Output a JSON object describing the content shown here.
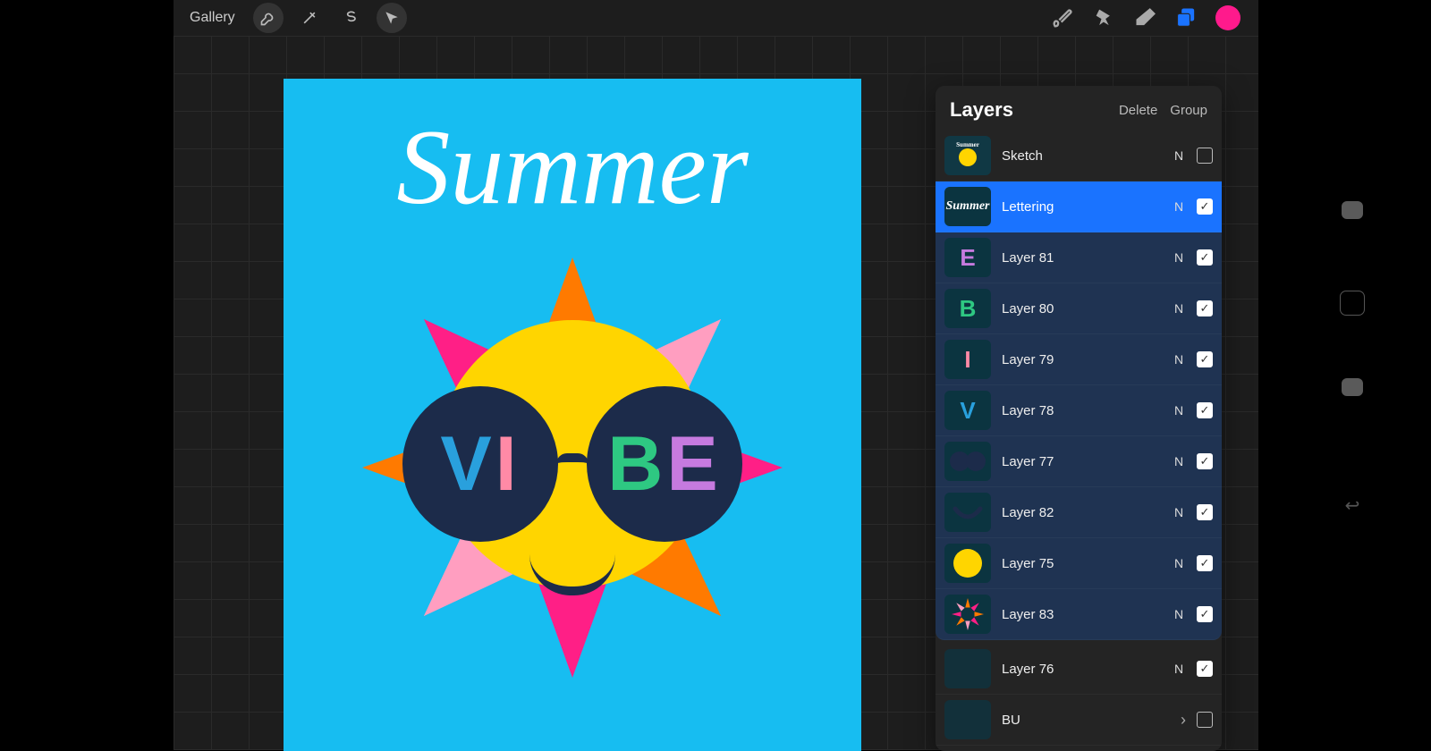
{
  "toolbar": {
    "gallery": "Gallery"
  },
  "canvas": {
    "title": "Summer",
    "vibe_v": "V",
    "vibe_i": "I",
    "vibe_b": "B",
    "vibe_e": "E"
  },
  "layers_panel": {
    "title": "Layers",
    "delete": "Delete",
    "group": "Group"
  },
  "layers": [
    {
      "name": "Sketch",
      "blend": "N",
      "visible": false,
      "grouped": false,
      "selected": false,
      "thumb": "sketch"
    },
    {
      "name": "Lettering",
      "blend": "N",
      "visible": true,
      "grouped": true,
      "selected": true,
      "thumb": "summer"
    },
    {
      "name": "Layer 81",
      "blend": "N",
      "visible": true,
      "grouped": true,
      "selected": false,
      "thumb": "E"
    },
    {
      "name": "Layer 80",
      "blend": "N",
      "visible": true,
      "grouped": true,
      "selected": false,
      "thumb": "B"
    },
    {
      "name": "Layer 79",
      "blend": "N",
      "visible": true,
      "grouped": true,
      "selected": false,
      "thumb": "I"
    },
    {
      "name": "Layer 78",
      "blend": "N",
      "visible": true,
      "grouped": true,
      "selected": false,
      "thumb": "V"
    },
    {
      "name": "Layer 77",
      "blend": "N",
      "visible": true,
      "grouped": true,
      "selected": false,
      "thumb": "glasses"
    },
    {
      "name": "Layer 82",
      "blend": "N",
      "visible": true,
      "grouped": true,
      "selected": false,
      "thumb": "smile"
    },
    {
      "name": "Layer 75",
      "blend": "N",
      "visible": true,
      "grouped": true,
      "selected": false,
      "thumb": "suncircle"
    },
    {
      "name": "Layer 83",
      "blend": "N",
      "visible": true,
      "grouped": true,
      "selected": false,
      "thumb": "sunburst",
      "last_group": true
    },
    {
      "name": "Layer 76",
      "blend": "N",
      "visible": true,
      "grouped": false,
      "selected": false,
      "thumb": "blank"
    },
    {
      "name": "BU",
      "blend": "",
      "visible": false,
      "grouped": false,
      "selected": false,
      "thumb": "blank",
      "is_group_row": true
    }
  ],
  "thumb_letter_colors": {
    "E": "#c67adf",
    "B": "#2ec882",
    "I": "#ff8aa6",
    "V": "#29a0dd"
  },
  "ray_colors": [
    "#ff7a00",
    "#ff9ec0",
    "#ff1f86",
    "#ff7a00",
    "#ff1f86",
    "#ff9ec0",
    "#ff7a00",
    "#ff1f86"
  ]
}
